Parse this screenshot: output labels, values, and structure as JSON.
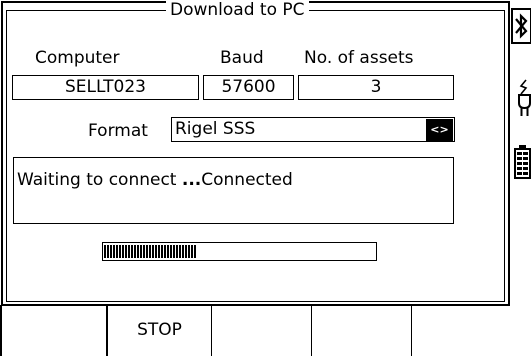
{
  "dialog": {
    "title": "Download to PC",
    "computer_label": "Computer",
    "baud_label": "Baud",
    "assets_label": "No. of assets",
    "computer_value": "SELLT023",
    "baud_value": "57600",
    "assets_value": "3",
    "format_label": "Format",
    "format_value": "Rigel SSS",
    "format_arrow": "<>",
    "status_prefix": "Waiting to connect ",
    "status_dots": "...",
    "status_suffix": "Connected",
    "progress": 0.34
  },
  "softkeys": [
    "",
    "STOP",
    "",
    "",
    ""
  ],
  "side_icons": [
    "bluetooth-icon",
    "power-plug-icon",
    "battery-icon"
  ]
}
